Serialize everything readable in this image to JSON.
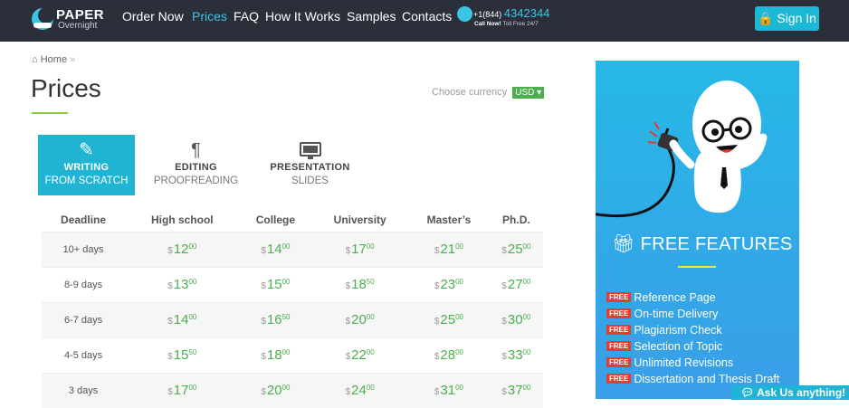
{
  "header": {
    "brand": "PAPER",
    "brand_sub": "Overnight",
    "nav": [
      {
        "label": "Order Now",
        "active": false
      },
      {
        "label": "Prices",
        "active": true
      },
      {
        "label": "FAQ",
        "active": false
      },
      {
        "label": "How It Works",
        "active": false
      },
      {
        "label": "Samples",
        "active": false
      },
      {
        "label": "Contacts",
        "active": false
      }
    ],
    "phone_prefix": "+1(844)",
    "phone_number": "4342344",
    "call_now": "Call Now!",
    "toll_free": "Toll Free 24/7",
    "signin": "Sign In"
  },
  "breadcrumb": {
    "home": "Home",
    "sep": "»"
  },
  "page_title": "Prices",
  "currency": {
    "label": "Choose currency",
    "value": "USD"
  },
  "tabs": [
    {
      "line1": "WRITING",
      "line2": "FROM SCRATCH",
      "icon": "pencil-icon",
      "active": true
    },
    {
      "line1": "EDITING",
      "line2": "PROOFREADING",
      "icon": "pilcrow-icon",
      "active": false
    },
    {
      "line1": "PRESENTATION",
      "line2": "SLIDES",
      "icon": "monitor-icon",
      "active": false
    }
  ],
  "table": {
    "headers": [
      "Deadline",
      "High school",
      "College",
      "University",
      "Master’s",
      "Ph.D."
    ],
    "currency_symbol": "$",
    "rows": [
      {
        "deadline": "10+ days",
        "prices": [
          [
            "12",
            "00"
          ],
          [
            "14",
            "00"
          ],
          [
            "17",
            "00"
          ],
          [
            "21",
            "00"
          ],
          [
            "25",
            "00"
          ]
        ]
      },
      {
        "deadline": "8-9 days",
        "prices": [
          [
            "13",
            "00"
          ],
          [
            "15",
            "00"
          ],
          [
            "18",
            "50"
          ],
          [
            "23",
            "00"
          ],
          [
            "27",
            "00"
          ]
        ]
      },
      {
        "deadline": "6-7 days",
        "prices": [
          [
            "14",
            "00"
          ],
          [
            "16",
            "50"
          ],
          [
            "20",
            "00"
          ],
          [
            "25",
            "00"
          ],
          [
            "30",
            "00"
          ]
        ]
      },
      {
        "deadline": "4-5 days",
        "prices": [
          [
            "15",
            "50"
          ],
          [
            "18",
            "00"
          ],
          [
            "22",
            "00"
          ],
          [
            "28",
            "00"
          ],
          [
            "33",
            "00"
          ]
        ]
      },
      {
        "deadline": "3 days",
        "prices": [
          [
            "17",
            "00"
          ],
          [
            "20",
            "00"
          ],
          [
            "24",
            "00"
          ],
          [
            "31",
            "00"
          ],
          [
            "37",
            "00"
          ]
        ]
      }
    ]
  },
  "features": {
    "title": "FREE FEATURES",
    "badge": "FREE",
    "items": [
      "Reference Page",
      "On-time Delivery",
      "Plagiarism Check",
      "Selection of Topic",
      "Unlimited Revisions",
      "Dissertation and Thesis Draft"
    ]
  },
  "chat": {
    "label": "Ask Us anything!"
  },
  "colors": {
    "nav_bg": "#2b2f3a",
    "accent": "#1fb4d4",
    "price_green": "#4bae4f",
    "free_red": "#e83a2d",
    "title_underline": "#8dc63f"
  }
}
